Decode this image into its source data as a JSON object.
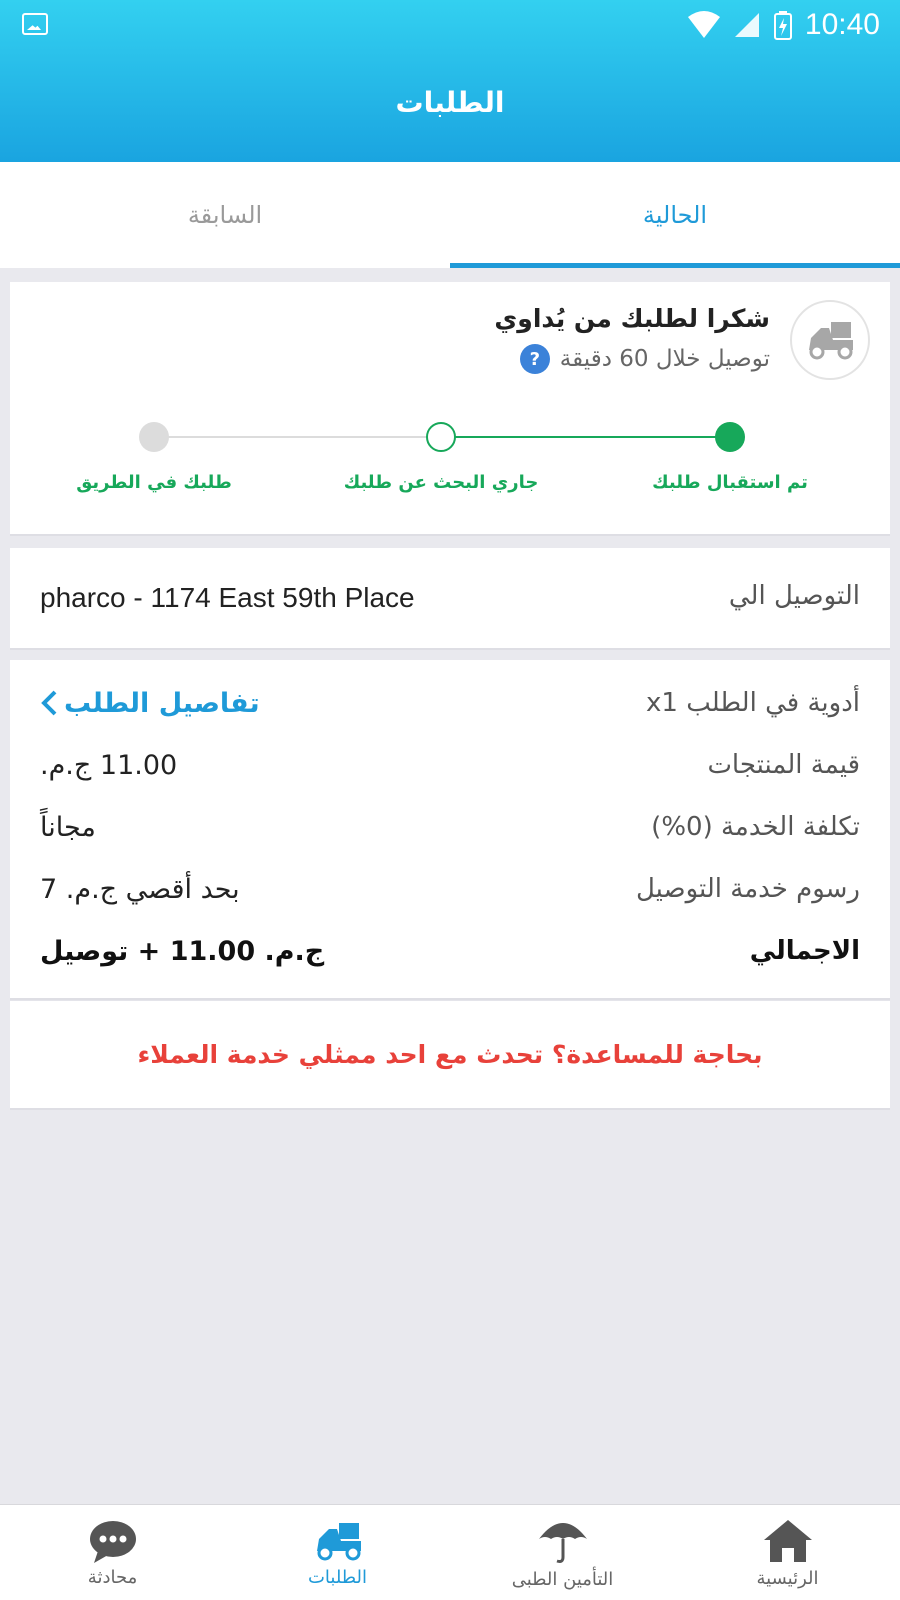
{
  "status_bar": {
    "time": "10:40"
  },
  "header": {
    "title": "الطلبات"
  },
  "tabs": [
    {
      "label": "الحالية",
      "active": true
    },
    {
      "label": "السابقة",
      "active": false
    }
  ],
  "order_status": {
    "thanks": "شكرا لطلبك من يُداوي",
    "delivery_time": "توصيل خلال 60 دقيقة",
    "help_icon": "?",
    "steps": [
      {
        "label": "تم استقبال طلبك",
        "state": "done"
      },
      {
        "label": "جاري البحث عن طلبك",
        "state": "current"
      },
      {
        "label": "طلبك في الطريق",
        "state": "pending"
      }
    ]
  },
  "address": {
    "label": "التوصيل الي",
    "value": "pharco - 1174 East 59th Place"
  },
  "details": {
    "items_label": "أدوية في الطلب",
    "items_count": "x1",
    "link_label": "تفاصيل الطلب",
    "rows": [
      {
        "label": "قيمة المنتجات",
        "value": "11.00 ج.م."
      },
      {
        "label": "تكلفة الخدمة (0%)",
        "value": "مجاناً"
      },
      {
        "label": "رسوم خدمة التوصيل",
        "value": "بحد أقصي ج.م. 7"
      }
    ],
    "total_label": "الاجمالي",
    "total_value": "ج.م. 11.00 + توصيل"
  },
  "help": {
    "text": "بحاجة للمساعدة؟ تحدث مع احد ممثلي خدمة العملاء"
  },
  "bottom_nav": [
    {
      "label": "الرئيسية",
      "icon": "home-icon"
    },
    {
      "label": "التأمين الطبى",
      "icon": "umbrella-icon"
    },
    {
      "label": "الطلبات",
      "icon": "delivery-truck-icon",
      "active": true
    },
    {
      "label": "محادثة",
      "icon": "chat-icon"
    }
  ],
  "colors": {
    "primary": "#1f9ad8",
    "success": "#17a85a",
    "alert": "#e8413a"
  }
}
